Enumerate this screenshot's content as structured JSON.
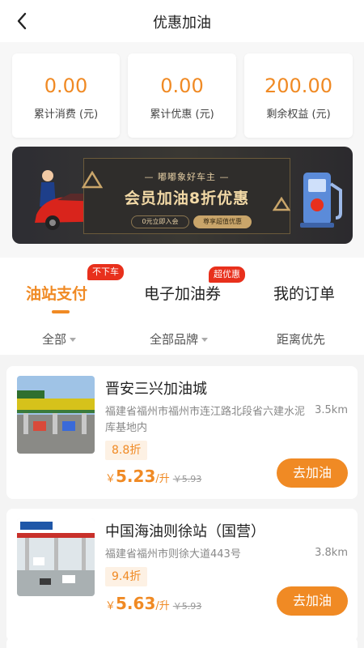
{
  "header": {
    "title": "优惠加油",
    "back_icon": "chevron-left-icon"
  },
  "stats": [
    {
      "value": "0.00",
      "label": "累计消费 (元)"
    },
    {
      "value": "0.00",
      "label": "累计优惠 (元)"
    },
    {
      "value": "200.00",
      "label": "剩余权益 (元)"
    }
  ],
  "banner": {
    "subtitle": "— 嘟嘟象好车主 —",
    "title": "会员加油8折优惠",
    "pill_left": "0元立即入会",
    "pill_right": "尊享超值优惠"
  },
  "tabs": [
    {
      "label": "油站支付",
      "active": true,
      "badge": "不下车"
    },
    {
      "label": "电子加油券",
      "active": false,
      "badge": "超优惠"
    },
    {
      "label": "我的订单",
      "active": false,
      "badge": ""
    }
  ],
  "filters": [
    {
      "label": "全部",
      "dropdown": true
    },
    {
      "label": "全部品牌",
      "dropdown": true
    },
    {
      "label": "距离优先",
      "dropdown": false
    }
  ],
  "stations": [
    {
      "name": "晋安三兴加油城",
      "address": "福建省福州市福州市连江路北段省六建水泥库基地内",
      "distance": "3.5km",
      "discount": "8.8折",
      "yen": "￥",
      "price": "5.23",
      "unit": "/升",
      "original_price": "￥5.93",
      "button": "去加油"
    },
    {
      "name": "中国海油则徐站（国营）",
      "address": "福建省福州市则徐大道443号",
      "distance": "3.8km",
      "discount": "9.4折",
      "yen": "￥",
      "price": "5.63",
      "unit": "/升",
      "original_price": "￥5.93",
      "button": "去加油"
    }
  ],
  "colors": {
    "accent": "#f08a24",
    "badge_red": "#e8301c",
    "banner_gold": "#f2d9a6"
  }
}
